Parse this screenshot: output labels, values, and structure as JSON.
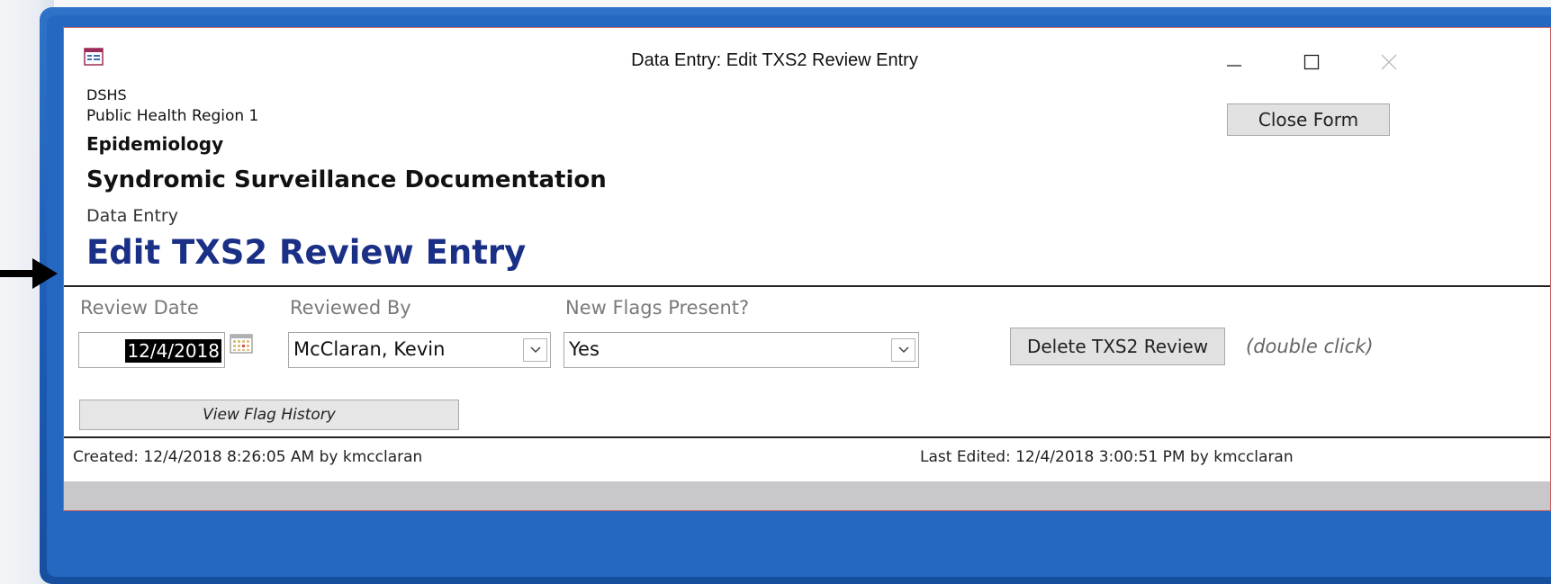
{
  "window": {
    "title": "Data Entry: Edit TXS2 Review Entry"
  },
  "header": {
    "org": "DSHS",
    "region": "Public Health Region 1",
    "department": "Epidemiology",
    "system": "Syndromic Surveillance Documentation",
    "section": "Data Entry",
    "form_title": "Edit TXS2 Review Entry"
  },
  "buttons": {
    "close_form": "Close Form",
    "delete_review": "Delete TXS2 Review",
    "delete_hint": "(double click)",
    "view_flag_history": "View Flag History"
  },
  "fields": {
    "review_date": {
      "label": "Review Date",
      "value": "12/4/2018"
    },
    "reviewed_by": {
      "label": "Reviewed By",
      "value": "McClaran, Kevin"
    },
    "new_flags": {
      "label": "New Flags Present?",
      "value": "Yes"
    }
  },
  "footer": {
    "created": "Created: 12/4/2018 8:26:05 AM by kmcclaran",
    "last_edited": "Last Edited: 12/4/2018 3:00:51 PM by kmcclaran"
  },
  "icons": {
    "app": "form-icon",
    "minimize": "minimize-icon",
    "maximize": "maximize-icon",
    "close": "close-icon",
    "calendar": "calendar-icon",
    "dropdown": "chevron-down-icon",
    "pointer": "arrow-right-icon"
  },
  "colors": {
    "frame_blue": "#2568c2",
    "title_blue": "#1a2f86",
    "window_border": "#c95f5f"
  }
}
